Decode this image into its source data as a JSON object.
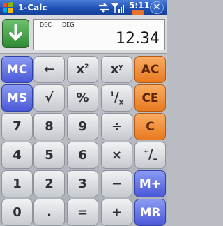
{
  "window": {
    "title": "1-Calc",
    "time": "5:11",
    "close_label": "✕"
  },
  "display": {
    "modes": [
      "DEC",
      "DEG"
    ],
    "value": "12.34"
  },
  "keys": {
    "mc": "MC",
    "ms": "MS",
    "mplus": "M+",
    "mr": "MR",
    "ac": "AC",
    "ce": "CE",
    "c": "C",
    "backspace": "←",
    "sqrt": "√",
    "percent": "%",
    "x2_base": "x",
    "x2_exp": "2",
    "xy_base": "x",
    "xy_exp": "y",
    "recip_num": "1",
    "recip_den": "x",
    "d7": "7",
    "d8": "8",
    "d9": "9",
    "d4": "4",
    "d5": "5",
    "d6": "6",
    "d1": "1",
    "d2": "2",
    "d3": "3",
    "d0": "0",
    "dot": ".",
    "equals": "=",
    "plus": "+",
    "minus": "−",
    "times": "×",
    "divide": "÷",
    "plusminus_plus": "+",
    "plusminus_minus": "–"
  },
  "colors": {
    "memory": "#5563e0",
    "clear": "#f0913a",
    "titlebar": "#1d4fb5",
    "enter": "#3e9a44"
  }
}
